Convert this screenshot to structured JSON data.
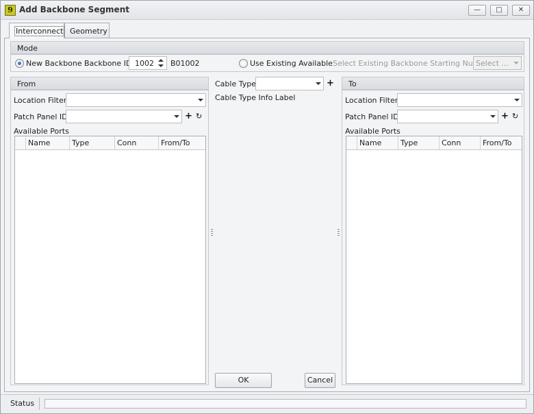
{
  "window": {
    "title": "Add Backbone Segment",
    "icon_glyph": "9",
    "controls": {
      "minimize": "—",
      "maximize": "□",
      "close": "✕"
    }
  },
  "tabs": [
    {
      "label": "Interconnect",
      "active": true
    },
    {
      "label": "Geometry",
      "active": false
    }
  ],
  "mode": {
    "header": "Mode",
    "new_backbone_label": "New Backbone",
    "new_backbone_selected": true,
    "backbone_id_label": "Backbone ID",
    "backbone_id_value": "1002",
    "backbone_code": "B01002",
    "use_existing_label": "Use Existing Available",
    "use_existing_selected": false,
    "select_existing_label": "Select Existing Backbone Starting Number",
    "select_existing_placeholder": "Select ..."
  },
  "from": {
    "header": "From",
    "location_filter_label": "Location Filter",
    "location_filter_value": "",
    "patch_panel_label": "Patch Panel ID",
    "patch_panel_value": "",
    "available_ports_label": "Available Ports",
    "columns": [
      "Name",
      "Type",
      "Conn",
      "From/To"
    ],
    "rows": []
  },
  "middle": {
    "cable_type_label": "Cable Type",
    "cable_type_value": "",
    "cable_type_info": "Cable Type Info Label",
    "ok_label": "OK",
    "cancel_label": "Cancel"
  },
  "to": {
    "header": "To",
    "location_filter_label": "Location Filter",
    "location_filter_value": "",
    "patch_panel_label": "Patch Panel ID",
    "patch_panel_value": "",
    "available_ports_label": "Available Ports",
    "columns": [
      "Name",
      "Type",
      "Conn",
      "From/To"
    ],
    "rows": []
  },
  "status": {
    "label": "Status",
    "progress": 0
  },
  "icons": {
    "add": "+",
    "refresh": "↻"
  },
  "colors": {
    "accent": "#3a7bd5",
    "panel_bg": "#f3f4f6",
    "header_bg": "#dcdfe3"
  }
}
